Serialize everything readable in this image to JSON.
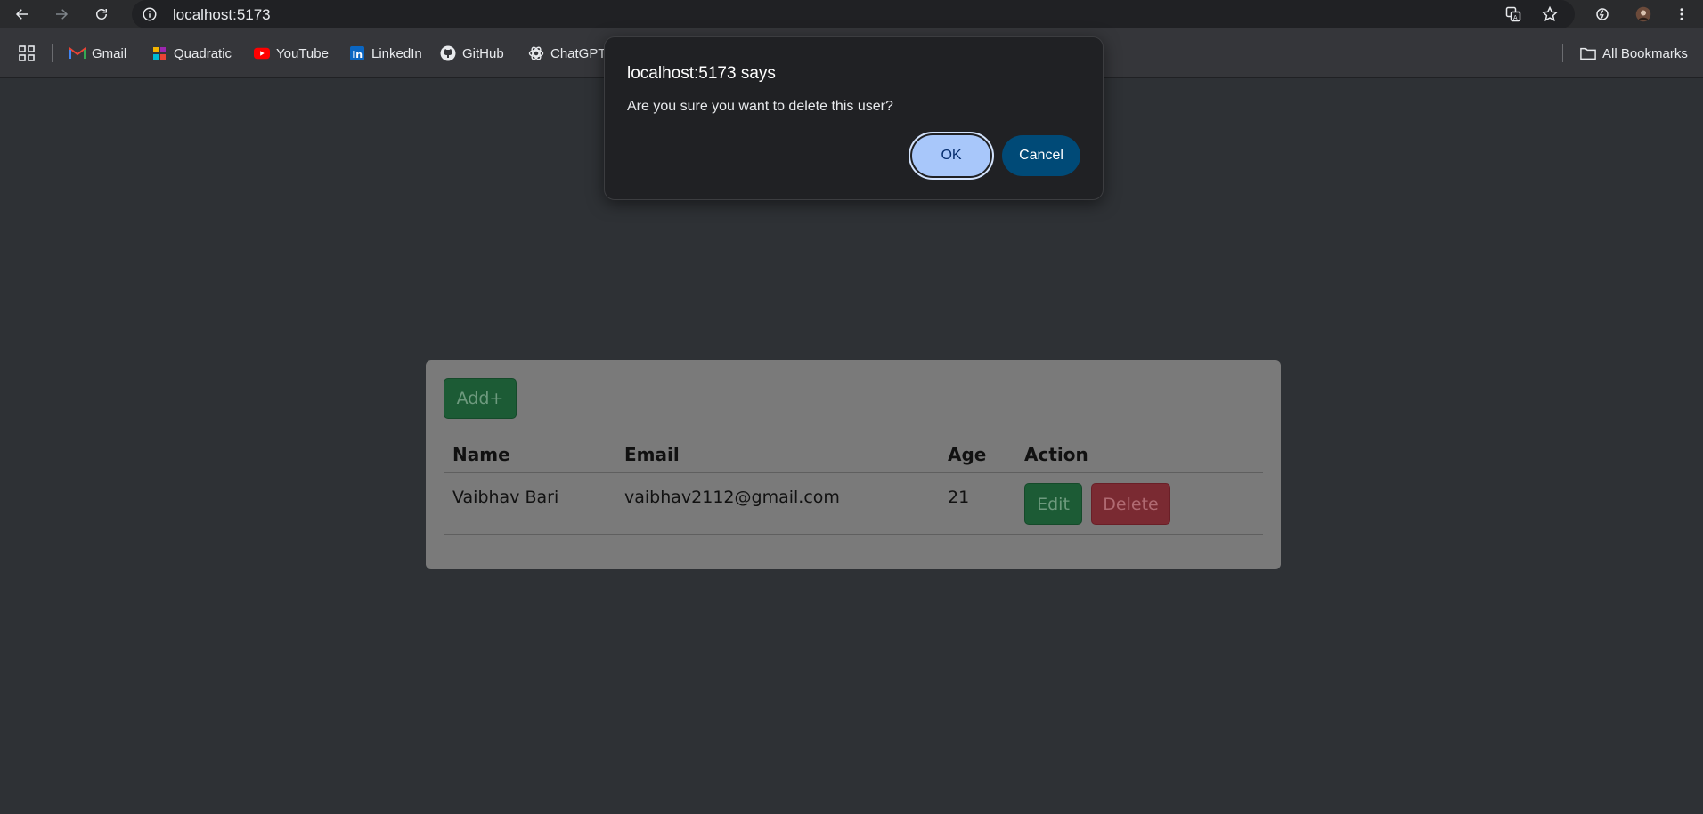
{
  "browser": {
    "url": "localhost:5173",
    "bookmarks": [
      {
        "label": "Gmail",
        "icon": "gmail-icon"
      },
      {
        "label": "Quadratic",
        "icon": "quadratic-icon"
      },
      {
        "label": "YouTube",
        "icon": "youtube-icon"
      },
      {
        "label": "LinkedIn",
        "icon": "linkedin-icon"
      },
      {
        "label": "GitHub",
        "icon": "github-icon"
      },
      {
        "label": "ChatGPT",
        "icon": "chatgpt-icon"
      }
    ],
    "all_bookmarks_label": "All Bookmarks"
  },
  "dialog": {
    "title": "localhost:5173 says",
    "message": "Are you sure you want to delete this user?",
    "ok_label": "OK",
    "cancel_label": "Cancel"
  },
  "page": {
    "add_label": "Add+",
    "columns": [
      "Name",
      "Email",
      "Age",
      "Action"
    ],
    "rows": [
      {
        "name": "Vaibhav Bari",
        "email": "vaibhav2112@gmail.com",
        "age": "21",
        "edit_label": "Edit",
        "delete_label": "Delete"
      }
    ]
  },
  "colors": {
    "background": "#2e3135",
    "ok_button": "#a8c7fa",
    "cancel_button": "#004a77",
    "success": "#1c5b35",
    "danger": "#7a2a32"
  }
}
